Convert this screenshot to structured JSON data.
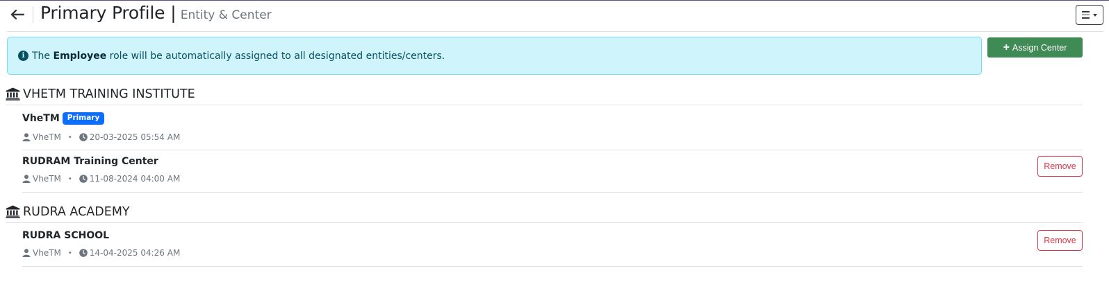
{
  "header": {
    "title": "Primary Profile",
    "separator": "|",
    "subtitle": "Entity & Center"
  },
  "alert": {
    "prefix": "The",
    "role": "Employee",
    "suffix": "role will be automatically assigned to all designated entities/centers."
  },
  "assign_button": {
    "label": "Assign Center"
  },
  "entities": [
    {
      "name": "VHETM TRAINING INSTITUTE",
      "centers": [
        {
          "name": "VheTM",
          "badge": "Primary",
          "user": "VheTM",
          "date": "20-03-2025 05:54 AM"
        },
        {
          "name": "RUDRAM Training Center",
          "user": "VheTM",
          "date": "11-08-2024 04:00 AM",
          "action": "Remove"
        }
      ]
    },
    {
      "name": "RUDRA ACADEMY",
      "centers": [
        {
          "name": "RUDRA SCHOOL",
          "user": "VheTM",
          "date": "14-04-2025 04:26 AM",
          "action": "Remove"
        }
      ]
    }
  ],
  "colors": {
    "alert_bg": "#cff4fc",
    "alert_border": "#6edff6",
    "assign_green": "#3f8a55",
    "badge_blue": "#0d6efd",
    "remove_red": "#dc3545"
  },
  "icons": [
    "arrow-left-icon",
    "menu-icon",
    "info-circle-icon",
    "plus-icon",
    "bank-icon",
    "user-icon",
    "clock-icon"
  ]
}
